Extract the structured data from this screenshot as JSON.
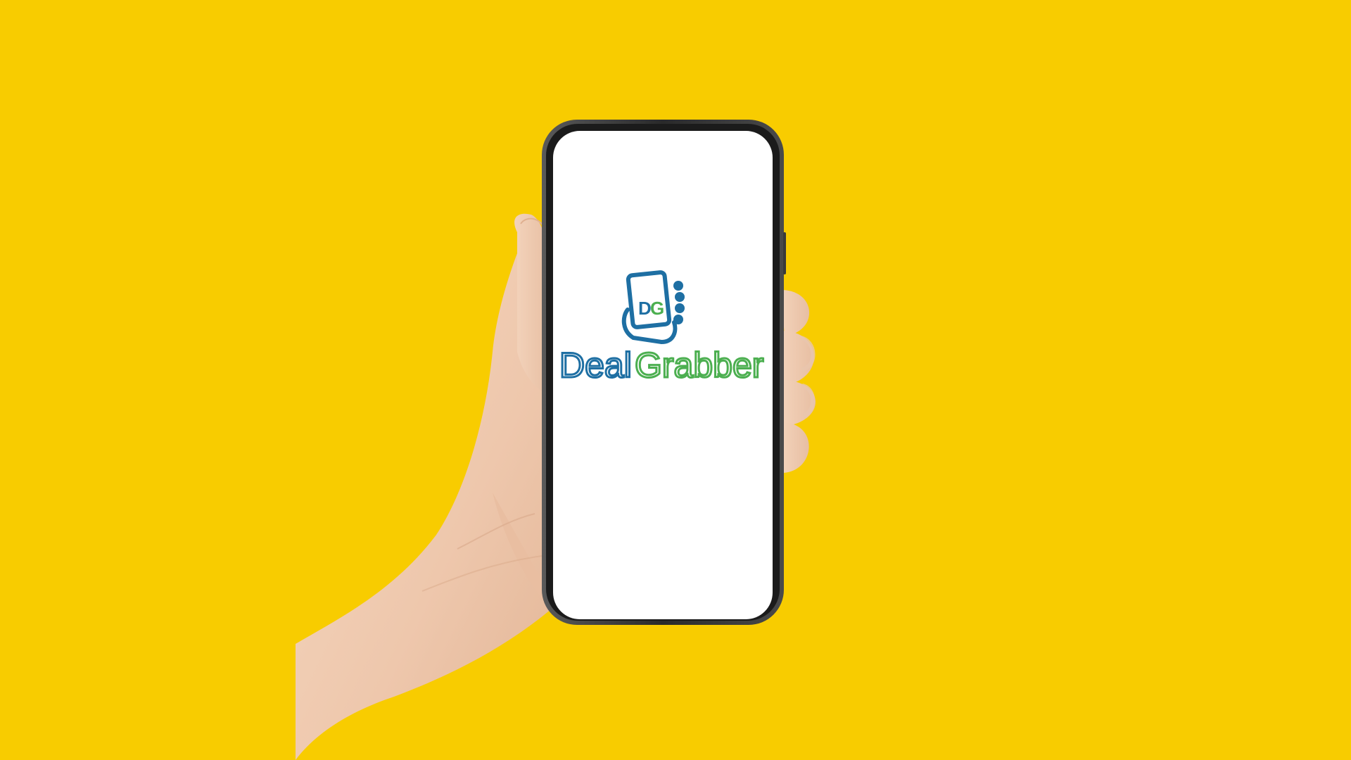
{
  "background_color": "#F8CC00",
  "logo": {
    "monogram": "DG",
    "word_first": "Deal",
    "word_second": "Grabber",
    "color_blue": "#1E6FA3",
    "color_green": "#4CAF50"
  },
  "phone": {
    "frame_color": "#2B2B2B",
    "screen_color": "#FFFFFF"
  },
  "hand": {
    "skin_color": "#F0CDB2"
  }
}
